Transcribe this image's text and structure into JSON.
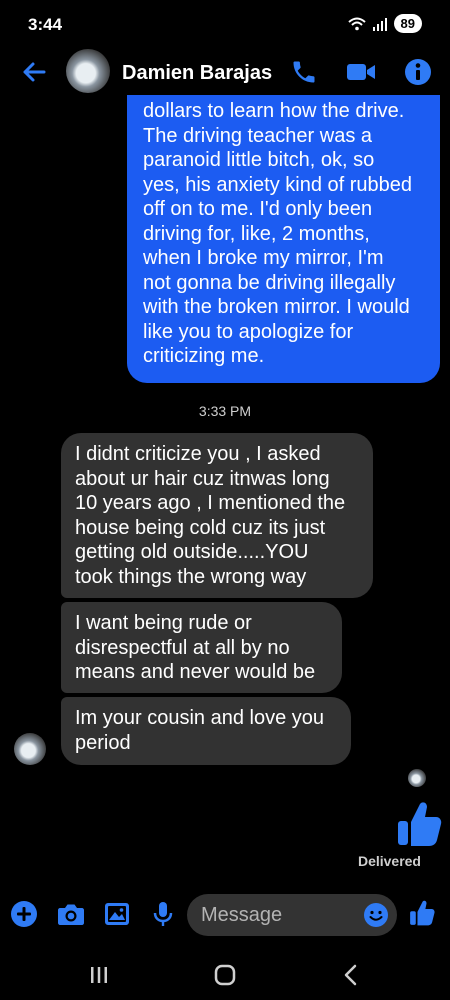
{
  "status_bar": {
    "time": "3:44",
    "battery": "89"
  },
  "header": {
    "contact_name": "Damien Barajas"
  },
  "outgoing": {
    "lines": [
      "dollars to learn how the drive.",
      "The driving teacher was a",
      "paranoid little bitch, ok, so",
      "yes, his anxiety kind of rubbed",
      "off on to me. I'd only been",
      "driving for, like, 2 months,",
      "when I broke my mirror, I'm",
      "not gonna be driving illegally",
      "with the broken mirror. I would",
      "like you to apologize for",
      "criticizing me."
    ]
  },
  "timestamp": "3:33 PM",
  "incoming": [
    {
      "lines": [
        "I didnt criticize you , I asked",
        "about ur hair cuz itnwas long",
        "10 years ago , I mentioned the",
        "house being cold cuz its just",
        "getting  old outside.....YOU",
        "took things the wrong way"
      ]
    },
    {
      "lines": [
        "I want being rude or",
        "disrespectful at all by no",
        "means and never would be"
      ]
    },
    {
      "lines": [
        "Im your cousin and love you",
        "period"
      ]
    }
  ],
  "delivered_label": "Delivered",
  "composer": {
    "placeholder": "Message"
  },
  "colors": {
    "accent": "#1c5cf2",
    "incoming_bubble": "#323232",
    "background": "#000000"
  }
}
